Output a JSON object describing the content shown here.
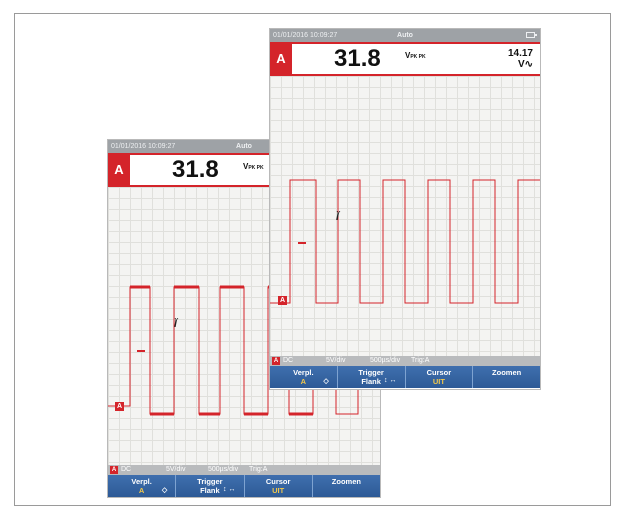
{
  "screens": [
    {
      "id": "back",
      "status": {
        "datetime": "01/01/2016 10:09:27",
        "mode": "Auto"
      },
      "readout": {
        "channel": "A",
        "value": "31.8",
        "unit": "V",
        "unit_sub": "PK PK"
      },
      "info": {
        "channel": "A",
        "coupling": "DC",
        "volts_div": "5V/div",
        "time_div": "500µs/div",
        "trigger": "Trig:A"
      },
      "softkeys": [
        {
          "label": "Verpl.",
          "sub": "A",
          "arrows": "◇"
        },
        {
          "label": "Trigger",
          "sub": "Flank",
          "arrows": "↕ ↔"
        },
        {
          "label": "Cursor",
          "sub": "UIT"
        },
        {
          "label": "Zoomen",
          "sub": ""
        }
      ]
    },
    {
      "id": "front",
      "status": {
        "datetime": "01/01/2016 10:09:27",
        "mode": "Auto"
      },
      "readout": {
        "channel": "A",
        "value": "31.8",
        "unit": "V",
        "unit_sub": "PK PK",
        "right_value": "14.17",
        "right_unit": "V∿"
      },
      "info": {
        "channel": "A",
        "coupling": "DC",
        "volts_div": "5V/div",
        "time_div": "500µs/div",
        "trigger": "Trig:A"
      },
      "softkeys": [
        {
          "label": "Verpl.",
          "sub": "A",
          "arrows": "◇"
        },
        {
          "label": "Trigger",
          "sub": "Flank",
          "arrows": "↕ ↔"
        },
        {
          "label": "Cursor",
          "sub": "UIT"
        },
        {
          "label": "Zoomen",
          "sub": ""
        }
      ]
    }
  ],
  "colors": {
    "accent_red": "#d4242a",
    "softkey_blue": "#2d5a96",
    "status_gray": "#9ea2a6",
    "grid": "#e0e0dc"
  }
}
